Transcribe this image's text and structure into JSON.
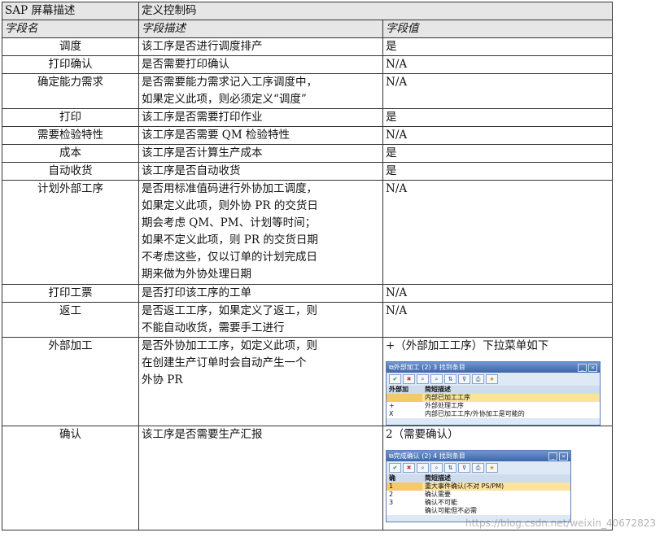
{
  "header": {
    "left": "SAP 屏幕描述",
    "right": "定义控制码"
  },
  "columns": [
    "字段名",
    "字段描述",
    "字段值"
  ],
  "rows": [
    {
      "name": "调度",
      "desc": "该工序是否进行调度排产",
      "value": "是"
    },
    {
      "name": "打印确认",
      "desc": "是否需要打印确认",
      "value": "N/A"
    },
    {
      "name": "确定能力需求",
      "desc": "是否需要能力需求记入工序调度中，\n如果定义此项，则必须定义“调度”",
      "value": "N/A"
    },
    {
      "name": "打印",
      "desc": "该工序是否需要打印作业",
      "value": "是"
    },
    {
      "name": "需要检验特性",
      "desc": "该工序是否需要 QM 检验特性",
      "value": "N/A"
    },
    {
      "name": "成本",
      "desc": "该工序是否计算生产成本",
      "value": "是"
    },
    {
      "name": "自动收货",
      "desc": "该工序是否自动收货",
      "value": "是"
    },
    {
      "name": "计划外部工序",
      "desc": "是否用标准值码进行外协加工调度，\n如果定义此项，则外协 PR 的交货日\n期会考虑 QM、PM、计划等时间；\n如果不定义此项，则 PR 的交货日期\n不考虑这些，仅以订单的计划完成日\n期来做为外协处理日期",
      "value": "N/A"
    },
    {
      "name": "打印工票",
      "desc": "是否打印该工序的工单",
      "value": "N/A"
    },
    {
      "name": "返工",
      "desc": "是否返工工序，如果定义了返工，则\n不能自动收货，需要手工进行",
      "value": "N/A"
    },
    {
      "name": "外部加工",
      "desc": "是否外协加工工序，如定义此项，则\n在创建生产订单时会自动产生一个\n外协 PR",
      "value": "+（外部加工工序）下拉菜单如下"
    },
    {
      "name": "确认",
      "desc": "该工序是否需要生产汇报",
      "value": "2（需要确认）"
    }
  ],
  "popup_ext": {
    "title": "外部加工 (2)   3 找到条目",
    "col1": "外部加",
    "col2": "简短描述",
    "items": [
      {
        "key": "",
        "text": "内部已加工工序"
      },
      {
        "key": "+",
        "text": "外部处理工序"
      },
      {
        "key": "X",
        "text": "内部已加工工序/外协加工是可能的"
      }
    ]
  },
  "popup_conf": {
    "title": "完成确认 (2)   4 找到条目",
    "col1": "确",
    "col2": "简短描述",
    "items": [
      {
        "key": "1",
        "text": "重大事件确认(不对 PS/PM)"
      },
      {
        "key": "2",
        "text": "确认需要"
      },
      {
        "key": "3",
        "text": "确认不可能"
      },
      {
        "key": "",
        "text": "确认可能但不必需"
      }
    ]
  },
  "watermark": "https://blog.csdn.net/weixin_40672823"
}
